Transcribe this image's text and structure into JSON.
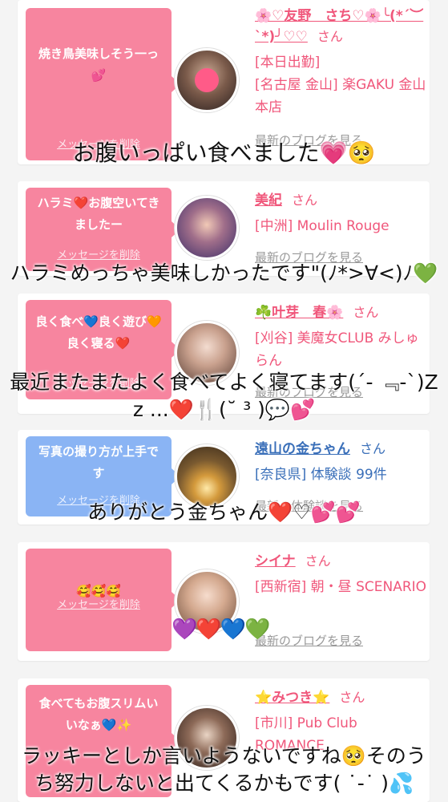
{
  "cards": [
    {
      "bubble": "焼き鳥美味しそう一っ💕",
      "delete": "メッセージを削除",
      "name": "🌸♡友野　さち♡🌸╰(*´︶`*)╯♡♡",
      "san": "さん",
      "shop": "[本日出勤]\n[名古屋 金山] 楽GAKU 金山本店",
      "blog": "最新のブログを見る"
    },
    {
      "bubble": "ハラミ❤️お腹空いてきましたー",
      "delete": "メッセージを削除",
      "name": "美紀",
      "san": "さん",
      "shop": "[中洲] Moulin Rouge",
      "blog": "最新のブログを見る"
    },
    {
      "bubble": "良く食べ💙良く遊び🧡良く寝る❤️",
      "delete": "メッセージを削除",
      "name": "☘️叶芽　春🌸",
      "san": "さん",
      "shop": "[刈谷] 美魔女CLUB みしゅらん",
      "blog": "最新のブログを見る"
    },
    {
      "bubble": "写真の撮り方が上手です",
      "delete": "メッセージを削除",
      "name": "遠山の金ちゃん",
      "san": "さん",
      "shop": "[奈良県] 体験談 99件",
      "blog": "最新の体験談を見る"
    },
    {
      "bubble": "🥰🥰🥰",
      "delete": "メッセージを削除",
      "name": "シイナ",
      "san": "さん",
      "shop": "[西新宿] 朝・昼 SCENARIO",
      "blog": "最新のブログを見る"
    },
    {
      "bubble": "食べてもお腹スリムいいなぁ💙✨",
      "delete": "メッセージを削除",
      "name": "⭐みつき⭐",
      "san": "さん",
      "shop": "[市川] Pub Club ROMANCE",
      "blog": ""
    }
  ],
  "overlays": {
    "o1": "お腹いっぱい食べました💗🥺",
    "o2": "ハラミめっちゃ美味しかったです\"(ﾉ*>∀<)ﾉ💚",
    "o3": "最近またまたよく食べてよく寝てます(´- ﹃-`)Z\nz ...❤️🍴(˘ ³ )💬💕",
    "o4": "ありがとう金ちゃん❤️♡💕💕",
    "o5": "💜❤️💙💚",
    "o6": "ラッキーとしか言いようないですね🥺そのう\nち努力しないと出てくるかもです( ˙-˙ )💦"
  },
  "colors": {
    "pink": "#f7859f",
    "blue": "#8ab4f4",
    "name_pink": "#f0577b",
    "name_blue": "#3a6fb9"
  }
}
